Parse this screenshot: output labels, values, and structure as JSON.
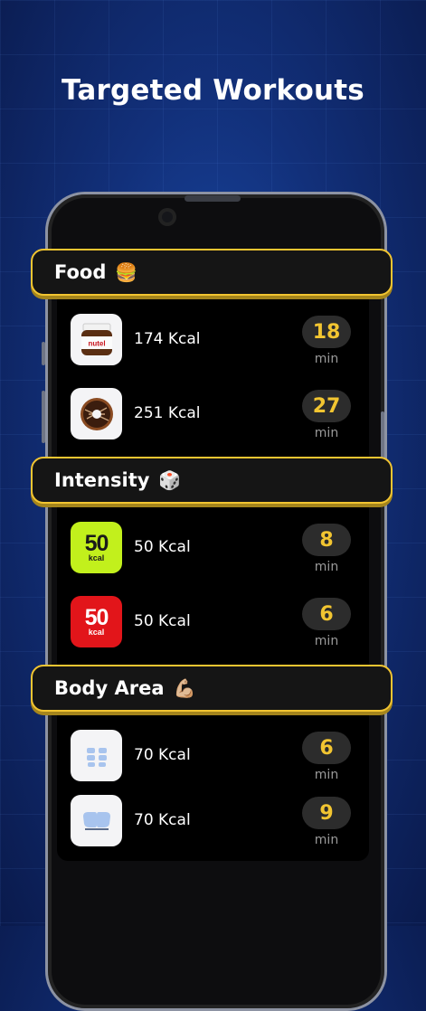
{
  "title": "Targeted Workouts",
  "categories": [
    {
      "label": "Food",
      "emoji": "🍔",
      "items": [
        {
          "icon": "nutella-jar-icon",
          "kcal": "174 Kcal",
          "minutes": "18",
          "unit": "min"
        },
        {
          "icon": "chocolate-donut-icon",
          "kcal": "251 Kcal",
          "minutes": "27",
          "unit": "min"
        }
      ]
    },
    {
      "label": "Intensity",
      "emoji": "🎲",
      "items": [
        {
          "icon": "intensity-50-green-icon",
          "icon_text": "50",
          "icon_sub": "kcal",
          "kcal": "50 Kcal",
          "minutes": "8",
          "unit": "min"
        },
        {
          "icon": "intensity-50-red-icon",
          "icon_text": "50",
          "icon_sub": "kcal",
          "kcal": "50 Kcal",
          "minutes": "6",
          "unit": "min"
        }
      ]
    },
    {
      "label": "Body Area",
      "emoji": "💪🏼",
      "items": [
        {
          "icon": "abs-icon",
          "kcal": "70 Kcal",
          "minutes": "6",
          "unit": "min"
        },
        {
          "icon": "chest-icon",
          "kcal": "70 Kcal",
          "minutes": "9",
          "unit": "min"
        }
      ]
    }
  ],
  "colors": {
    "accent": "#f2c531",
    "background": "#12307a",
    "card": "#151515",
    "badge": "#2c2c2c"
  }
}
